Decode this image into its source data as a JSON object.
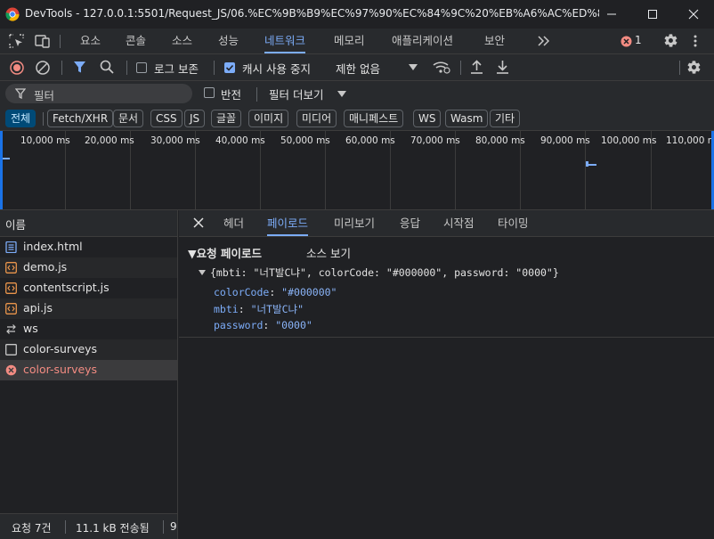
{
  "window": {
    "title": "DevTools - 127.0.0.1:5501/Request_JS/06.%EC%9B%B9%EC%97%90%EC%84%9C%20%EB%A6%AC%ED%80%98%EC..."
  },
  "main_tabs": [
    "요소",
    "콘솔",
    "소스",
    "성능",
    "네트워크",
    "메모리",
    "애플리케이션",
    "보안"
  ],
  "error_count": "1",
  "toolbar": {
    "preserve_log": "로그 보존",
    "disable_cache": "캐시 사용 중지",
    "throttling": "제한 없음"
  },
  "filter": {
    "placeholder": "필터",
    "invert": "반전",
    "more_filters": "필터 더보기"
  },
  "type_filters": [
    "전체",
    "Fetch/XHR",
    "문서",
    "CSS",
    "JS",
    "글꼴",
    "이미지",
    "미디어",
    "매니페스트",
    "WS",
    "Wasm",
    "기타"
  ],
  "timeline_ticks": [
    "10,000 ms",
    "20,000 ms",
    "30,000 ms",
    "40,000 ms",
    "50,000 ms",
    "60,000 ms",
    "70,000 ms",
    "80,000 ms",
    "90,000 ms",
    "100,000 ms",
    "110,000 m"
  ],
  "list": {
    "header": "이름",
    "requests": [
      {
        "name": "index.html",
        "type": "document"
      },
      {
        "name": "demo.js",
        "type": "script"
      },
      {
        "name": "contentscript.js",
        "type": "script"
      },
      {
        "name": "api.js",
        "type": "script"
      },
      {
        "name": "ws",
        "type": "websocket"
      },
      {
        "name": "color-surveys",
        "type": "fetch"
      },
      {
        "name": "color-surveys",
        "type": "error"
      }
    ]
  },
  "status": {
    "requests": "요청 7건",
    "transferred": "11.1 kB 전송됨",
    "more": "9"
  },
  "detail_tabs": [
    "헤더",
    "페이로드",
    "미리보기",
    "응답",
    "시작점",
    "타이밍"
  ],
  "payload": {
    "section_title": "▼요청 페이로드",
    "view_source": "소스 보기",
    "summary": "{mbti: \"너T발C냐\", colorCode: \"#000000\", password: \"0000\"}",
    "fields": [
      {
        "key": "colorCode",
        "value": "\"#000000\""
      },
      {
        "key": "mbti",
        "value": "\"너T발C냐\""
      },
      {
        "key": "password",
        "value": "\"0000\""
      }
    ]
  },
  "colors": {
    "accent": "#7cacf8",
    "error": "#f28b82",
    "background": "#202124",
    "panel": "#282a2d"
  }
}
